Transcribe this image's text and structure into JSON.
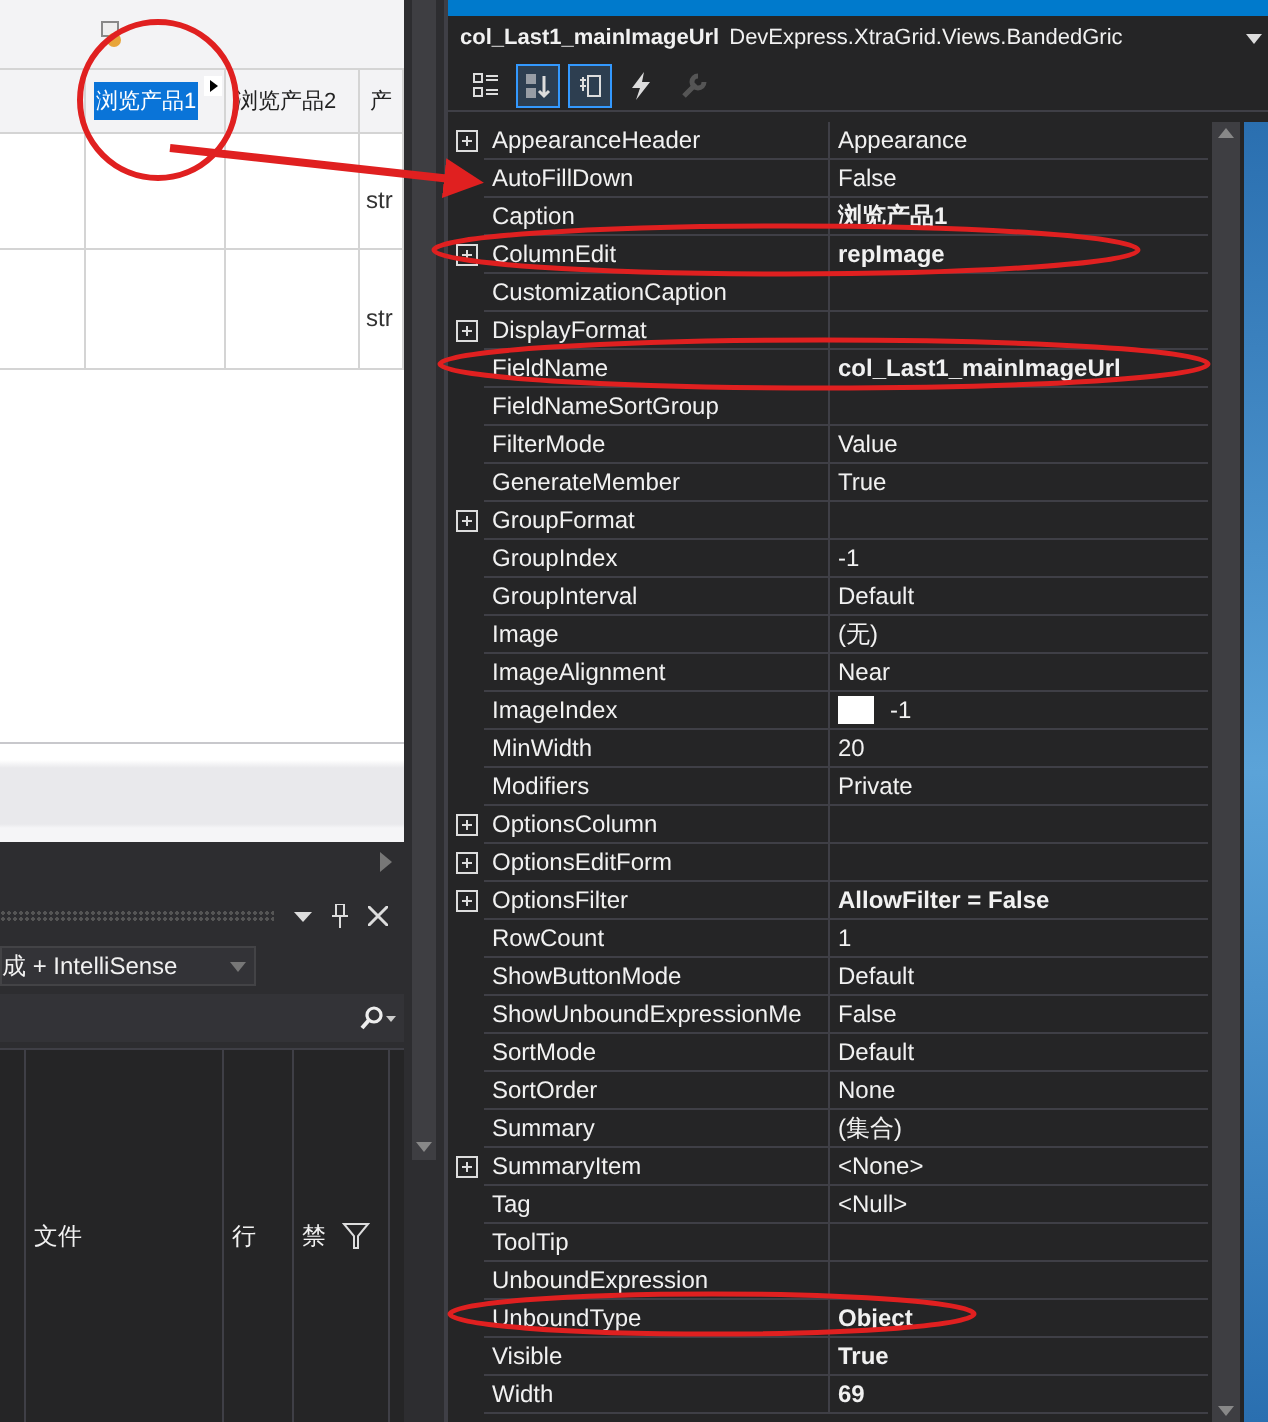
{
  "designer": {
    "header_cells": [
      {
        "label": "浏览产品1",
        "selected": true
      },
      {
        "label": "浏览产品2",
        "selected": false
      },
      {
        "label": "产",
        "selected": false
      }
    ],
    "rows": [
      [
        "str"
      ],
      [
        "str"
      ]
    ]
  },
  "output_panel": {
    "dropdown": "成 + IntelliSense",
    "columns": [
      "文件",
      "行",
      "禁"
    ]
  },
  "properties": {
    "object_name": "col_Last1_mainImageUrl",
    "object_type": "DevExpress.XtraGrid.Views.BandedGric",
    "toolbar": [
      {
        "kind": "categorized",
        "selected": false,
        "disabled": false
      },
      {
        "kind": "alphabetical",
        "selected": true,
        "disabled": false
      },
      {
        "kind": "properties",
        "selected": true,
        "disabled": false
      },
      {
        "kind": "events",
        "selected": false,
        "disabled": false
      },
      {
        "kind": "pages",
        "selected": false,
        "disabled": true
      }
    ],
    "rows": [
      {
        "name": "AppearanceHeader",
        "value": "Appearance",
        "expandable": true,
        "bold": false
      },
      {
        "name": "AutoFillDown",
        "value": "False",
        "expandable": false,
        "bold": false
      },
      {
        "name": "Caption",
        "value": "浏览产品1",
        "expandable": false,
        "bold": true
      },
      {
        "name": "ColumnEdit",
        "value": "repImage",
        "expandable": true,
        "bold": true
      },
      {
        "name": "CustomizationCaption",
        "expandable": false
      },
      {
        "name": "DisplayFormat",
        "expandable": true
      },
      {
        "name": "FieldName",
        "value": "col_Last1_mainImageUrl",
        "expandable": false,
        "bold": true
      },
      {
        "name": "FieldNameSortGroup",
        "expandable": false
      },
      {
        "name": "FilterMode",
        "value": "Value",
        "expandable": false,
        "bold": false
      },
      {
        "name": "GenerateMember",
        "value": "True",
        "expandable": false,
        "bold": false
      },
      {
        "name": "GroupFormat",
        "expandable": true
      },
      {
        "name": "GroupIndex",
        "value": "-1",
        "expandable": false,
        "bold": false
      },
      {
        "name": "GroupInterval",
        "value": "Default",
        "expandable": false,
        "bold": false
      },
      {
        "name": "Image",
        "value": "(无)",
        "expandable": false,
        "bold": false
      },
      {
        "name": "ImageAlignment",
        "value": "Near",
        "expandable": false,
        "bold": false
      },
      {
        "name": "ImageIndex",
        "value": "-1",
        "expandable": false,
        "bold": false,
        "swatch": true
      },
      {
        "name": "MinWidth",
        "value": "20",
        "expandable": false,
        "bold": false
      },
      {
        "name": "Modifiers",
        "value": "Private",
        "expandable": false,
        "bold": false
      },
      {
        "name": "OptionsColumn",
        "expandable": true
      },
      {
        "name": "OptionsEditForm",
        "expandable": true
      },
      {
        "name": "OptionsFilter",
        "value": "AllowFilter = False",
        "expandable": true,
        "bold": true
      },
      {
        "name": "RowCount",
        "value": "1",
        "expandable": false,
        "bold": false
      },
      {
        "name": "ShowButtonMode",
        "value": "Default",
        "expandable": false,
        "bold": false
      },
      {
        "name": "ShowUnboundExpressionMe",
        "value": "False",
        "expandable": false,
        "bold": false
      },
      {
        "name": "SortMode",
        "value": "Default",
        "expandable": false,
        "bold": false
      },
      {
        "name": "SortOrder",
        "value": "None",
        "expandable": false,
        "bold": false
      },
      {
        "name": "Summary",
        "value": "(集合)",
        "expandable": false,
        "bold": false
      },
      {
        "name": "SummaryItem",
        "value": "<None>",
        "expandable": true,
        "bold": false
      },
      {
        "name": "Tag",
        "value": "<Null>",
        "expandable": false,
        "bold": false
      },
      {
        "name": "ToolTip",
        "expandable": false
      },
      {
        "name": "UnboundExpression",
        "expandable": false
      },
      {
        "name": "UnboundType",
        "value": "Object",
        "expandable": false,
        "bold": true
      },
      {
        "name": "Visible",
        "value": "True",
        "expandable": false,
        "bold": true
      },
      {
        "name": "Width",
        "value": "69",
        "expandable": false,
        "bold": true
      }
    ]
  }
}
